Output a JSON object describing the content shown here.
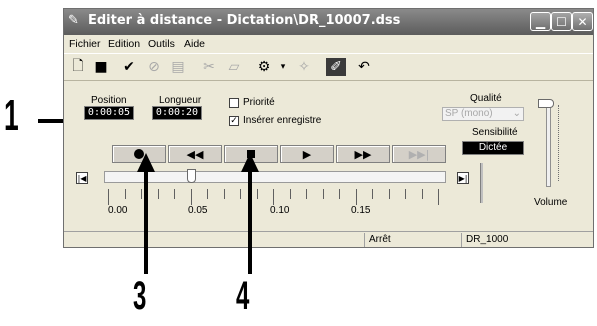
{
  "window": {
    "title": "Editer à distance - Dictation\\DR_10007.dss",
    "title_icon": "pen-icon",
    "controls": [
      "minimize-icon",
      "maximize-icon",
      "close-icon"
    ]
  },
  "menu": {
    "items": [
      "Fichier",
      "Edition",
      "Outils",
      "Aide"
    ]
  },
  "toolbar": {
    "icons": [
      "new-icon",
      "save-icon",
      "check-icon",
      "cancel-icon",
      "book-icon",
      "cut-icon",
      "paste-icon",
      "settings-icon",
      "dropdown-icon",
      "sparkle-icon",
      "wrench-icon",
      "undo-icon"
    ]
  },
  "position": {
    "label": "Position",
    "value": "0:00:05"
  },
  "length": {
    "label": "Longueur",
    "value": "0:00:20"
  },
  "options": {
    "priority": {
      "label": "Priorité",
      "checked": false
    },
    "insert_record": {
      "label": "Insérer enregistre",
      "checked": true
    }
  },
  "quality": {
    "label": "Qualité",
    "selected": "SP (mono)"
  },
  "sensitivity": {
    "label": "Sensibilité",
    "value": "Dictée"
  },
  "volume": {
    "label": "Volume"
  },
  "transport": {
    "buttons": [
      "record-icon",
      "rewind-icon",
      "stop-icon",
      "play-icon",
      "fast-forward-icon",
      "skip-end-icon"
    ]
  },
  "timeline": {
    "labels": [
      "0.00",
      "0.05",
      "0.10",
      "0.15"
    ],
    "position_fraction": 0.25
  },
  "status": {
    "state": "Arrêt",
    "file": "DR_1000"
  },
  "callouts": [
    "1",
    "3",
    "4"
  ]
}
